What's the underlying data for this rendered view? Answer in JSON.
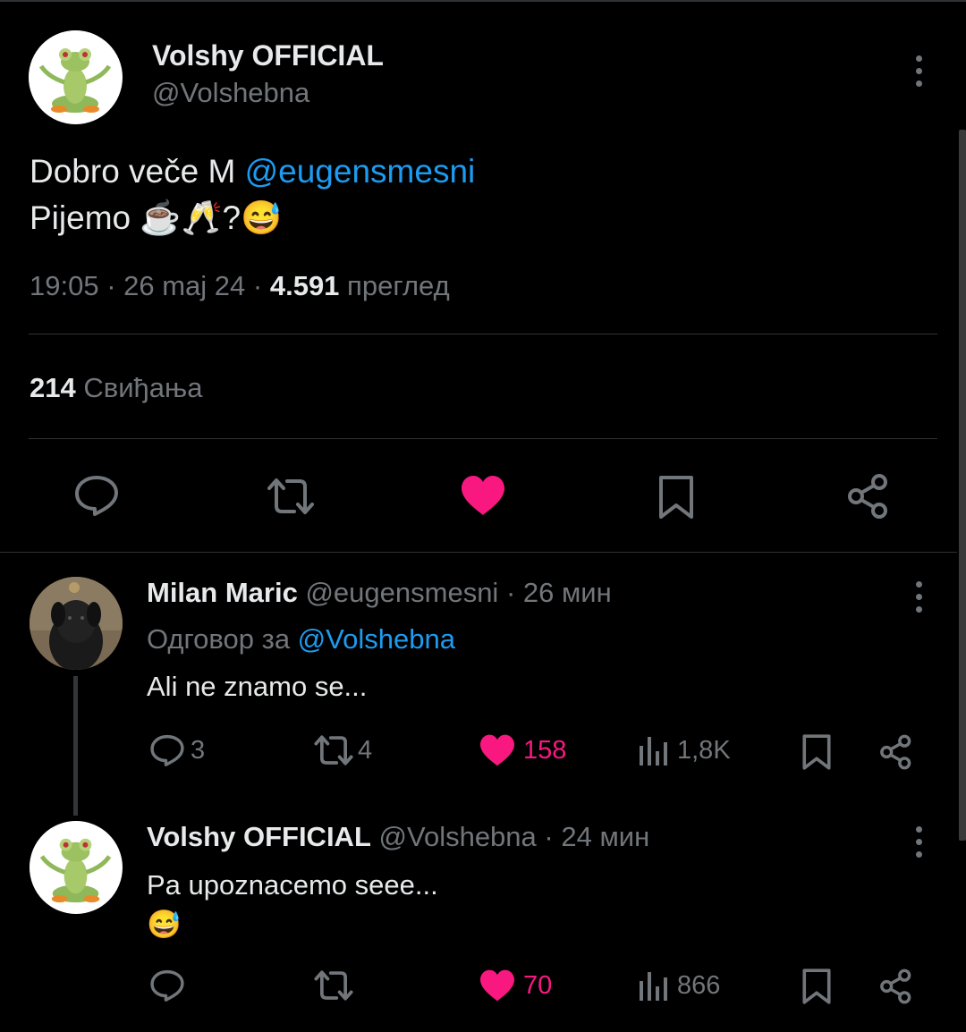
{
  "main_tweet": {
    "author_name": "Volshy OFFICIAL",
    "author_handle": "@Volshebna",
    "text_line1_prefix": "Dobro veče M ",
    "text_mention": "@eugensmesni",
    "text_line2": "Pijemo ☕🥂?😅",
    "time": "19:05",
    "date": "26 maj 24",
    "views_count": "4.591",
    "views_label": "преглед",
    "likes_count": "214",
    "likes_label": "Свиђања"
  },
  "replies": [
    {
      "author_name": "Milan Maric",
      "author_handle": "@eugensmesni",
      "time_ago": "26 мин",
      "reply_to_label": "Одговор за ",
      "reply_to_handle": "@Volshebna",
      "text": "Ali ne znamo se...",
      "reply_count": "3",
      "retweet_count": "4",
      "like_count": "158",
      "view_count": "1,8K"
    },
    {
      "author_name": "Volshy OFFICIAL",
      "author_handle": "@Volshebna",
      "time_ago": "24 мин",
      "text_line1": "Pa upoznacemo seee...",
      "text_line2": "😅",
      "reply_count": "",
      "retweet_count": "",
      "like_count": "70",
      "view_count": "866"
    }
  ],
  "colors": {
    "background": "#000000",
    "text": "#e7e9ea",
    "muted": "#71767b",
    "link": "#1d9bf0",
    "like": "#f91880",
    "divider": "#2f3336"
  },
  "icons": {
    "reply": "reply-icon",
    "retweet": "retweet-icon",
    "like": "heart-icon",
    "bookmark": "bookmark-icon",
    "share": "share-icon",
    "views": "views-icon",
    "more": "more-icon"
  }
}
